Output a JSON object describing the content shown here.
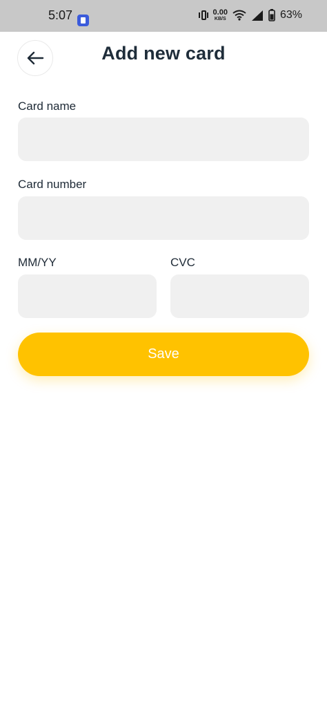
{
  "status_bar": {
    "time": "5:07",
    "net_speed_value": "0.00",
    "net_speed_unit": "KB/S",
    "battery_percent": "63%",
    "icons": [
      "app-icon",
      "vibrate-icon",
      "wifi-icon",
      "signal-icon",
      "battery-icon"
    ]
  },
  "header": {
    "title": "Add new card",
    "back_icon": "arrow-left-icon"
  },
  "form": {
    "card_name_label": "Card name",
    "card_name_value": "",
    "card_number_label": "Card number",
    "card_number_value": "",
    "expiry_label": "MM/YY",
    "expiry_value": "",
    "cvc_label": "CVC",
    "cvc_value": "",
    "save_label": "Save"
  },
  "colors": {
    "accent": "#ffc200",
    "input_bg": "#f0f0f0",
    "title": "#1f2d3a"
  }
}
